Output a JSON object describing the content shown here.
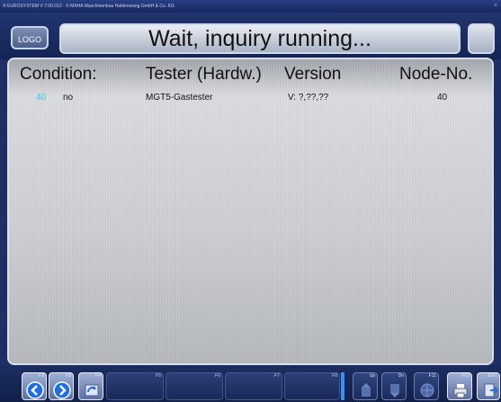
{
  "window": {
    "title": "© EUROSYSTEM V 7.00.012 · © MAHA Maschinenbau Haldenwang GmbH & Co. KG",
    "close_glyph": "×"
  },
  "header": {
    "logo_label": "LOGO",
    "title": "Wait, inquiry running..."
  },
  "table": {
    "headers": [
      "Condition:",
      "Tester (Hardw.)",
      "Version",
      "Node-No."
    ],
    "rows": [
      {
        "node": "40",
        "condition": "no",
        "tester": "MGT5-Gastester",
        "version": "V:  ?,??,??",
        "node_nr": "40"
      }
    ],
    "highlight_color": "#3bc7e8"
  },
  "footer": {
    "keys": [
      {
        "label": "F2",
        "icon": "arrow-left-icon"
      },
      {
        "label": "F3",
        "icon": "arrow-right-icon"
      },
      {
        "label": "F4",
        "icon": "refresh-icon"
      },
      {
        "label": "F5",
        "icon": ""
      },
      {
        "label": "F6",
        "icon": ""
      },
      {
        "label": "F7",
        "icon": ""
      },
      {
        "label": "F8",
        "icon": ""
      },
      {
        "label": "Up",
        "icon": "up-icon"
      },
      {
        "label": "Dn",
        "icon": "down-icon"
      },
      {
        "label": "F11",
        "icon": "globe-icon"
      },
      {
        "label": "F12",
        "icon": "printer-icon"
      },
      {
        "label": "ESC",
        "icon": "exit-icon"
      }
    ]
  }
}
